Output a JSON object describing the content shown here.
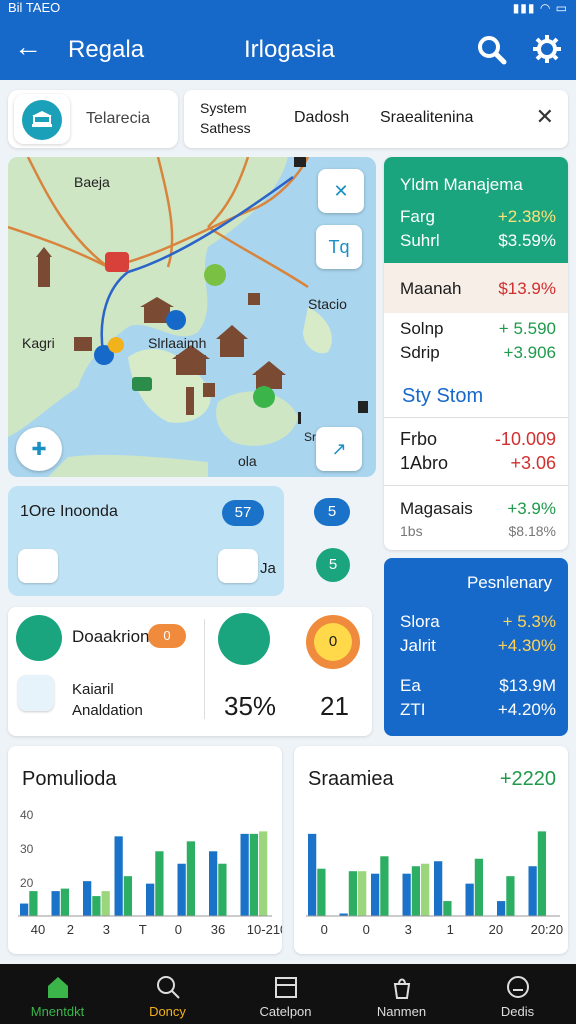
{
  "status_bar": {
    "left": "Bil TAEO",
    "right": "▮▮▮ ◠ ▭"
  },
  "app_bar": {
    "back_icon": "arrow-left-icon",
    "title_left": "Regala",
    "title_center": "Irlogasia",
    "search_icon": "search-icon",
    "settings_icon": "gear-icon"
  },
  "filter": {
    "label": "Telarecia",
    "logo_icon": "bank-icon"
  },
  "tabs": {
    "item1": "System Sathess",
    "item2": "Dadosh",
    "item3": "Sraealitenina",
    "close_icon": "close-icon"
  },
  "map": {
    "labels": {
      "top": "Baeja",
      "left": "Kagri",
      "center": "Slrlaaimh",
      "right": "Stacio",
      "bottom": "ola",
      "bottom2": "Sr"
    },
    "buttons": {
      "b1": "✕",
      "b2": "Tq",
      "b3": "✚",
      "b4": "↗"
    }
  },
  "stocks": {
    "header_title": "Yldm Manajema",
    "rows": [
      {
        "name": "Farg",
        "value": "+2.38%"
      },
      {
        "name": "Suhrl",
        "value": "$3.59%"
      },
      {
        "name": "Maanah",
        "value": "$13.9%"
      },
      {
        "name": "Solnp",
        "value": "+ 5.590"
      },
      {
        "name": "Sdrip",
        "value": "+3.906"
      }
    ],
    "subheader": "Sty Stom",
    "rows2": [
      {
        "name": "Frbo",
        "value": "-10.009"
      },
      {
        "name": "1Abro",
        "value": "+3.06"
      },
      {
        "name": "Magasais",
        "value": "+3.9%"
      },
      {
        "name": "1bs",
        "value": "$8.18%"
      }
    ]
  },
  "lightpanel": {
    "label": "1Ore Inoonda",
    "pill1": "57",
    "pill2": "5",
    "pill3": "5",
    "ja": "Ja"
  },
  "bluecard": {
    "title": "Pesnlenary",
    "rows": [
      {
        "name": "Slora",
        "value": "+ 5.3%"
      },
      {
        "name": "Jalrit",
        "value": "+4.30%"
      },
      {
        "name": "Ea",
        "value": "$13.9M"
      },
      {
        "name": "ZTI",
        "value": "+4.20%"
      }
    ]
  },
  "kpi": {
    "item1": "Doaakrion",
    "badge1": "0",
    "item2": "Kaiaril Analdation",
    "value1": "35%",
    "value2": "21",
    "badge2": "0"
  },
  "chart_left": {
    "title": "Pomulioda",
    "yticks": [
      "40",
      "30",
      "20"
    ],
    "xticks": [
      "40",
      "2",
      "3",
      "T",
      "0",
      "36",
      "10-210"
    ]
  },
  "chart_right": {
    "title": "Sraamiea",
    "delta": "+2220",
    "xticks": [
      "0",
      "0",
      "3",
      "1",
      "20",
      "20:20"
    ]
  },
  "chart_data": [
    {
      "type": "bar",
      "title": "Pomulioda",
      "ylim": [
        0,
        45
      ],
      "series": [
        {
          "color": "#1a73c9",
          "values": [
            5,
            10,
            14,
            32,
            13,
            21,
            26,
            33
          ]
        },
        {
          "color": "#2cae63",
          "values": [
            10,
            11,
            8,
            16,
            26,
            30,
            21,
            33
          ]
        },
        {
          "color": "#9bd67d",
          "values": [
            0,
            0,
            10,
            0,
            0,
            0,
            0,
            34
          ]
        }
      ]
    },
    {
      "type": "bar",
      "title": "Sraamiea",
      "ylim": [
        0,
        45
      ],
      "series": [
        {
          "color": "#1a73c9",
          "values": [
            33,
            1,
            17,
            17,
            22,
            13,
            6,
            20
          ]
        },
        {
          "color": "#2cae63",
          "values": [
            19,
            18,
            24,
            20,
            6,
            23,
            16,
            34
          ]
        },
        {
          "color": "#9bd67d",
          "values": [
            0,
            18,
            0,
            21,
            0,
            0,
            0,
            0
          ]
        }
      ]
    }
  ],
  "bottom_nav": [
    {
      "label": "Mnentdkt",
      "icon": "home-icon"
    },
    {
      "label": "Doncy",
      "icon": "search-icon"
    },
    {
      "label": "Catelpon",
      "icon": "calendar-icon"
    },
    {
      "label": "Nanmen",
      "icon": "bag-icon"
    },
    {
      "label": "Dedis",
      "icon": "face-icon"
    }
  ],
  "colors": {
    "primary": "#1769c9",
    "green": "#1aa57e",
    "positive": "#1e9a4a",
    "negative": "#d12f2f",
    "amber": "#f2b21b"
  }
}
